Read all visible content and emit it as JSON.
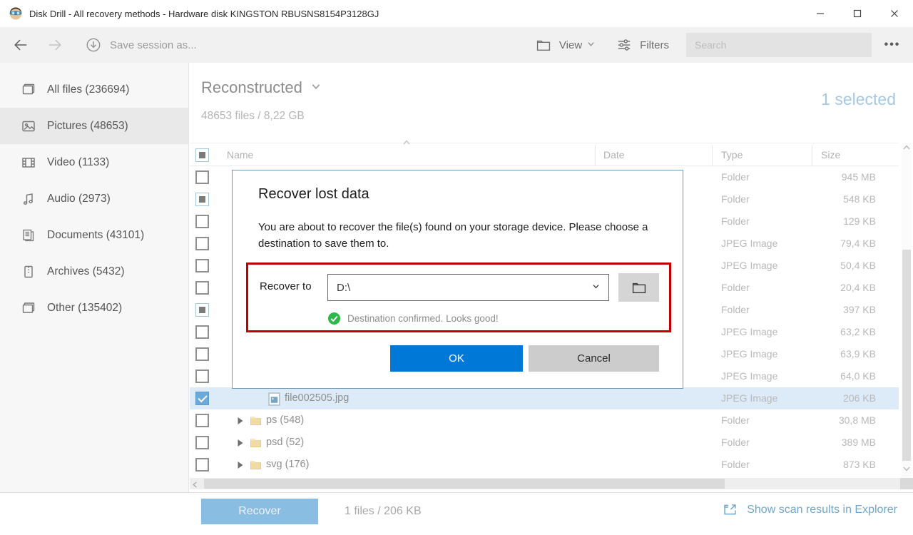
{
  "window": {
    "title": "Disk Drill - All recovery methods - Hardware disk KINGSTON RBUSNS8154P3128GJ"
  },
  "toolbar": {
    "save_session_label": "Save session as...",
    "view_label": "View",
    "filters_label": "Filters",
    "search_placeholder": "Search"
  },
  "sidebar": {
    "items": [
      {
        "id": "all-files",
        "label": "All files (236694)",
        "icon": "all-files",
        "selected": false
      },
      {
        "id": "pictures",
        "label": "Pictures (48653)",
        "icon": "pictures",
        "selected": true
      },
      {
        "id": "video",
        "label": "Video (1133)",
        "icon": "video",
        "selected": false
      },
      {
        "id": "audio",
        "label": "Audio (2973)",
        "icon": "audio",
        "selected": false
      },
      {
        "id": "documents",
        "label": "Documents (43101)",
        "icon": "documents",
        "selected": false
      },
      {
        "id": "archives",
        "label": "Archives (5432)",
        "icon": "archives",
        "selected": false
      },
      {
        "id": "other",
        "label": "Other (135402)",
        "icon": "other",
        "selected": false
      }
    ]
  },
  "main": {
    "category_label": "Reconstructed",
    "summary": "48653 files / 8,22 GB",
    "selection_status": "1 selected",
    "table": {
      "columns": {
        "name": "Name",
        "date": "Date",
        "type": "Type",
        "size": "Size"
      },
      "rows": [
        {
          "checkbox": "unchecked",
          "kind": "hidden",
          "name": "",
          "type": "Folder",
          "size": "945 MB"
        },
        {
          "checkbox": "indeterminate",
          "kind": "hidden",
          "name": "",
          "type": "Folder",
          "size": "548 KB"
        },
        {
          "checkbox": "unchecked",
          "kind": "hidden",
          "name": "",
          "type": "Folder",
          "size": "129 KB"
        },
        {
          "checkbox": "unchecked",
          "kind": "hidden",
          "name": "",
          "type": "JPEG Image",
          "size": "79,4 KB"
        },
        {
          "checkbox": "unchecked",
          "kind": "hidden",
          "name": "",
          "type": "JPEG Image",
          "size": "50,4 KB"
        },
        {
          "checkbox": "unchecked",
          "kind": "hidden",
          "name": "",
          "type": "Folder",
          "size": "20,4 KB"
        },
        {
          "checkbox": "indeterminate",
          "kind": "hidden",
          "name": "",
          "type": "Folder",
          "size": "397 KB"
        },
        {
          "checkbox": "unchecked",
          "kind": "hidden",
          "name": "",
          "type": "JPEG Image",
          "size": "63,2 KB"
        },
        {
          "checkbox": "unchecked",
          "kind": "hidden",
          "name": "",
          "type": "JPEG Image",
          "size": "63,9 KB"
        },
        {
          "checkbox": "unchecked",
          "kind": "hidden",
          "name": "",
          "type": "JPEG Image",
          "size": "64,0 KB"
        },
        {
          "checkbox": "checked",
          "kind": "file",
          "name": "file002505.jpg",
          "type": "JPEG Image",
          "size": "206 KB",
          "selected": true
        },
        {
          "checkbox": "unchecked",
          "kind": "folder",
          "name": "ps (548)",
          "type": "Folder",
          "size": "30,8 MB"
        },
        {
          "checkbox": "unchecked",
          "kind": "folder",
          "name": "psd (52)",
          "type": "Folder",
          "size": "389 MB"
        },
        {
          "checkbox": "unchecked",
          "kind": "folder",
          "name": "svg (176)",
          "type": "Folder",
          "size": "873 KB"
        }
      ]
    }
  },
  "dialog": {
    "title": "Recover lost data",
    "message": "You are about to recover the file(s) found on your storage device. Please choose a destination to save them to.",
    "recover_to_label": "Recover to",
    "destination_value": "D:\\",
    "confirmation_message": "Destination confirmed. Looks good!",
    "ok_label": "OK",
    "cancel_label": "Cancel",
    "accent_color": "#0078d7",
    "confirm_color": "#2db84b",
    "annotation_color": "#c00000"
  },
  "footer": {
    "recover_label": "Recover",
    "selection_summary": "1 files / 206 KB",
    "explorer_link_label": "Show scan results in Explorer"
  }
}
